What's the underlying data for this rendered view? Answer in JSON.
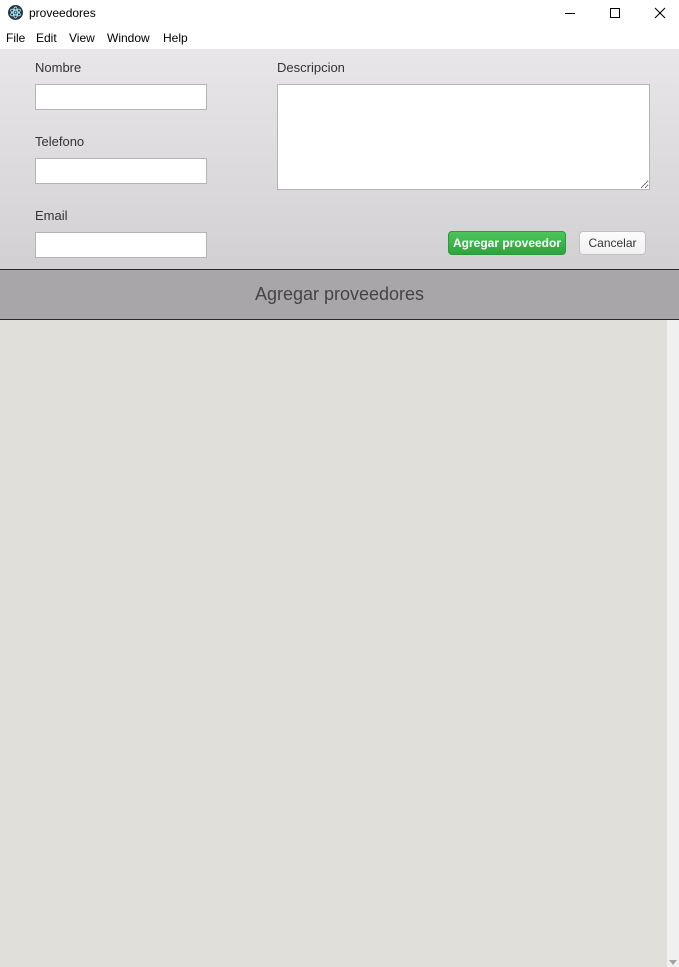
{
  "window": {
    "title": "proveedores",
    "icon": "electron-atom-icon"
  },
  "menubar": {
    "items": [
      {
        "label": "File"
      },
      {
        "label": "Edit"
      },
      {
        "label": "View"
      },
      {
        "label": "Window"
      },
      {
        "label": "Help"
      }
    ]
  },
  "form": {
    "nombre_label": "Nombre",
    "nombre_value": "",
    "telefono_label": "Telefono",
    "telefono_value": "",
    "email_label": "Email",
    "email_value": "",
    "descripcion_label": "Descripcion",
    "descripcion_value": "",
    "submit_label": "Agregar proveedor",
    "cancel_label": "Cancelar"
  },
  "header": {
    "title": "Agregar proveedores"
  },
  "colors": {
    "primary_button": "#34ab43",
    "header_band": "#a8a6a8",
    "content_bg": "#e0dfda"
  }
}
